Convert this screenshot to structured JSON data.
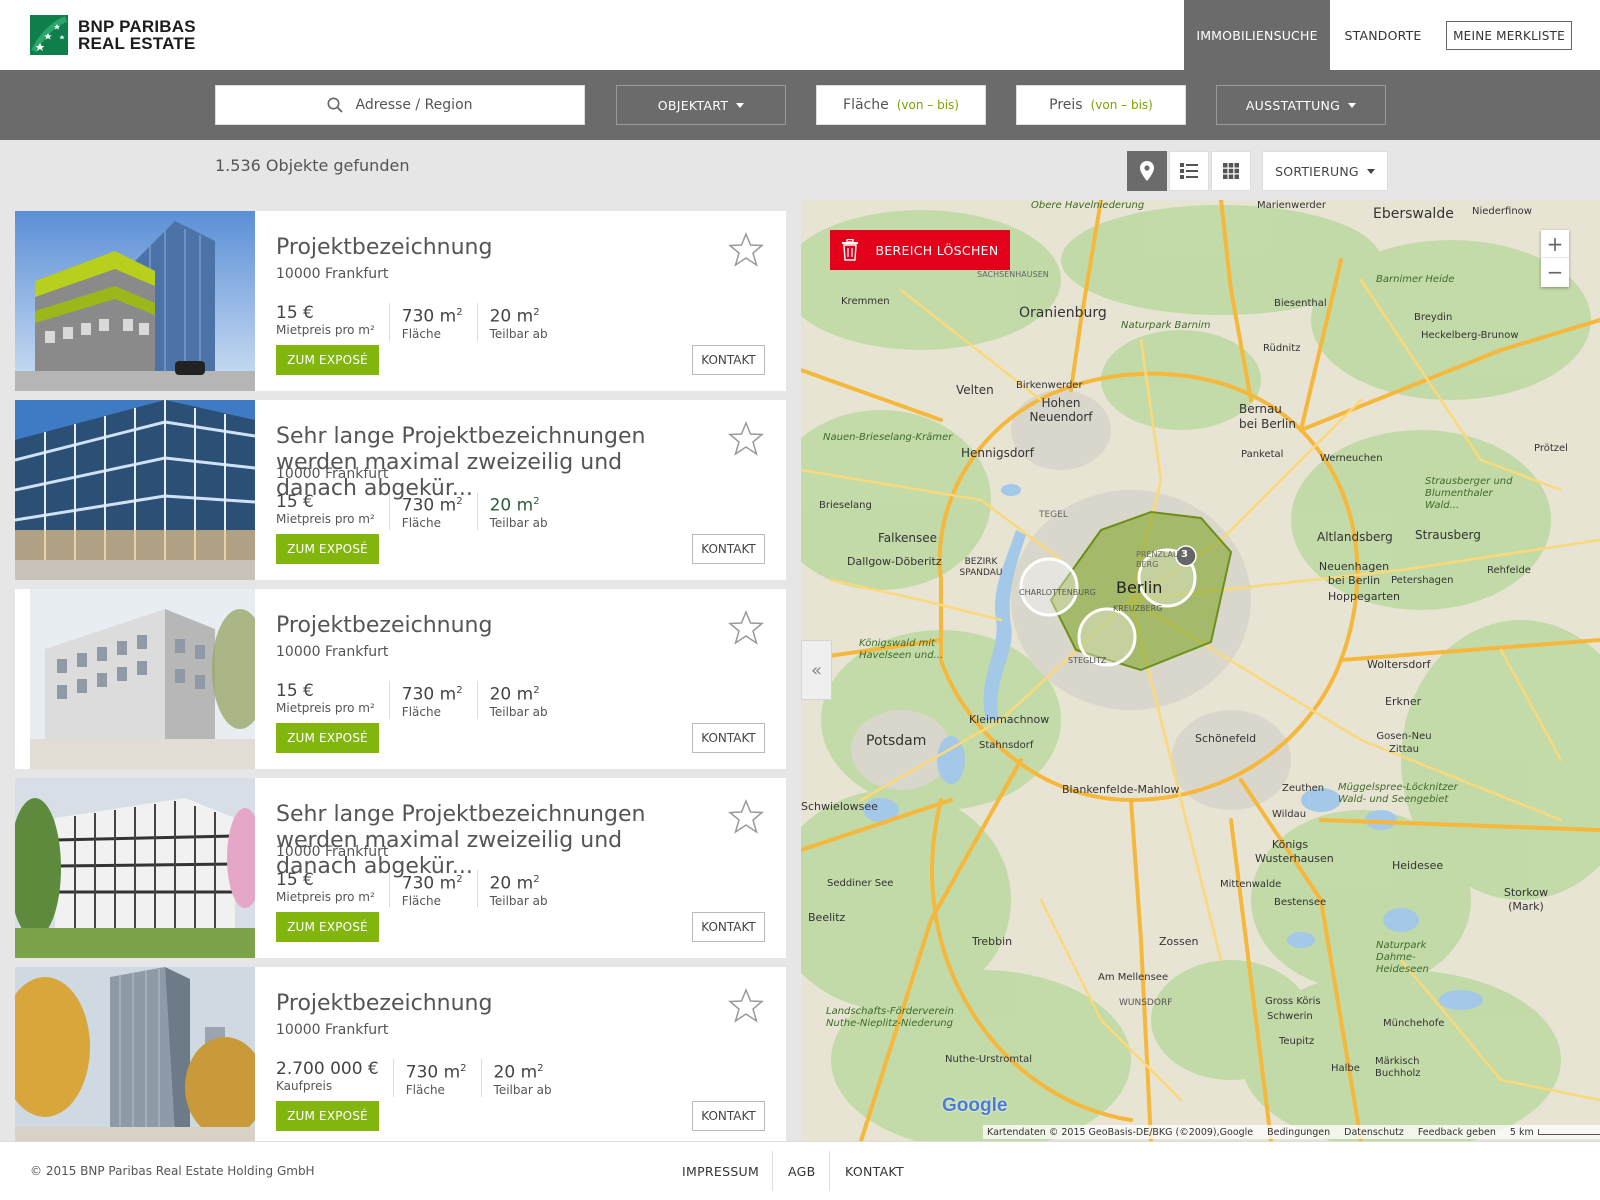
{
  "header": {
    "logo_line1": "BNP PARIBAS",
    "logo_line2": "REAL ESTATE",
    "nav_search": "IMMOBILIENSUCHE",
    "nav_locations": "STANDORTE",
    "nav_watchlist": "MEINE MERKLISTE"
  },
  "search": {
    "address_placeholder": "Adresse / Region",
    "type_label": "OBJEKTART",
    "area_label": "Fläche",
    "area_range": "(von – bis)",
    "price_label": "Preis",
    "price_range": "(von – bis)",
    "equipment_label": "AUSSTATTUNG"
  },
  "results": {
    "count_text": "1.536 Objekte gefunden",
    "sort_label": "SORTIERUNG"
  },
  "listings": [
    {
      "title": "Projektbezeichnung",
      "city": "10000 Frankfurt",
      "price": "15 €",
      "price_label": "Mietpreis pro m²",
      "area": "730 m",
      "area_label": "Fläche",
      "divisible": "20 m",
      "divisible_label": "Teilbar ab",
      "expose": "ZUM EXPOSÉ",
      "contact": "KONTAKT"
    },
    {
      "title": "Sehr lange Projektbezeichnungen werden maximal zweizeilig und danach abgekür...",
      "city": "10000 Frankfurt",
      "price": "15 €",
      "price_label": "Mietpreis pro m²",
      "area": "730 m",
      "area_label": "Fläche",
      "divisible": "20 m",
      "divisible_label": "Teilbar ab",
      "expose": "ZUM EXPOSÉ",
      "contact": "KONTAKT"
    },
    {
      "title": "Projektbezeichnung",
      "city": "10000 Frankfurt",
      "price": "15 €",
      "price_label": "Mietpreis pro m²",
      "area": "730 m",
      "area_label": "Fläche",
      "divisible": "20 m",
      "divisible_label": "Teilbar ab",
      "expose": "ZUM EXPOSÉ",
      "contact": "KONTAKT"
    },
    {
      "title": "Sehr lange Projektbezeichnungen werden maximal zweizeilig und danach abgekür...",
      "city": "10000 Frankfurt",
      "price": "15 €",
      "price_label": "Mietpreis pro m²",
      "area": "730 m",
      "area_label": "Fläche",
      "divisible": "20 m",
      "divisible_label": "Teilbar ab",
      "expose": "ZUM EXPOSÉ",
      "contact": "KONTAKT"
    },
    {
      "title": "Projektbezeichnung",
      "city": "10000 Frankfurt",
      "price": "2.700 000 €",
      "price_label": "Kaufpreis",
      "area": "730 m",
      "area_label": "Fläche",
      "divisible": "20 m",
      "divisible_label": "Teilbar ab",
      "expose": "ZUM EXPOSÉ",
      "contact": "KONTAKT"
    }
  ],
  "map": {
    "clear_area": "BEREICH LÖSCHEN",
    "zoom_in": "+",
    "zoom_out": "−",
    "cluster_count": "3",
    "city_main": "Berlin",
    "places": {
      "eberswalde": "Eberswalde",
      "marienwerder": "Marienwerder",
      "niederfinow": "Niederfinow",
      "obere_havel": "Obere Havelniederung",
      "oranienburg": "Oranienburg",
      "kremmen": "Kremmen",
      "biesenthal": "Biesenthal",
      "barnimer_heide": "Barnimer Heide",
      "breydin": "Breydin",
      "heckelberg": "Heckelberg-Brunow",
      "naturpark_barnim": "Naturpark Barnim",
      "ruednitz": "Rüdnitz",
      "velten": "Velten",
      "birkenwerder": "Birkenwerder",
      "hohen_neuendorf": "Hohen Neuendorf",
      "bernau": "Bernau bei Berlin",
      "nauen": "Nauen-Brieselang-Krämer",
      "hennigsdorf": "Hennigsdorf",
      "panketal": "Panketal",
      "werneuchen": "Werneuchen",
      "brieselang": "Brieselang",
      "falkensee": "Falkensee",
      "dallgow": "Dallgow-Döberitz",
      "spandau": "BEZIRK SPANDAU",
      "tegel": "TEGEL",
      "prenzlauer": "PRENZLAUER BERG",
      "charlottenburg": "CHARLOTTENBURG",
      "kreuzberg": "KREUZBERG",
      "steglitz": "STEGLITZ",
      "altlandsberg": "Altlandsberg",
      "strausberg": "Strausberg",
      "neuenhagen": "Neuenhagen bei Berlin",
      "petershagen": "Petershagen",
      "hoppegarten": "Hoppegarten",
      "koenigswald": "Königswald mit Havelseen und...",
      "woltersdorf": "Woltersdorf",
      "erkner": "Erkner",
      "kleinmachnow": "Kleinmachnow",
      "potsdam": "Potsdam",
      "stahnsdorf": "Stahnsdorf",
      "schoenefeld": "Schönefeld",
      "gosen": "Gosen-Neu Zittau",
      "blankenfelde": "Blankenfelde-Mahlow",
      "zeuthen": "Zeuthen",
      "wildau": "Wildau",
      "mueggelspree": "Müggelspree-Löcknitzer Wald- und Seengebiet",
      "schwielowsee": "Schwielowsee",
      "koenigs": "Königs Wusterhausen",
      "heidesee": "Heidesee",
      "mittenwalde": "Mittenwalde",
      "seddiner": "Seddiner See",
      "bestensee": "Bestensee",
      "storkow": "Storkow (Mark)",
      "beelitz": "Beelitz",
      "trebbin": "Trebbin",
      "zossen": "Zossen",
      "dahme": "Naturpark Dahme-Heideseen",
      "am_mellensee": "Am Mellensee",
      "wunsdorf": "WUNSDORF",
      "gross_koris": "Gross Köris",
      "schwerin": "Schwerin",
      "muenchehofe": "Münchehofe",
      "nuthe": "Landschafts-Förderverein Nuthe-Nieplitz-Niederung",
      "teupitz": "Teupitz",
      "nuthe_urstromtal": "Nuthe-Urstromtal",
      "halbe": "Halbe",
      "maerkisch": "Märkisch Buchholz",
      "rehfelde": "Rehfelde",
      "proetzel": "Prötzel",
      "strausberger": "Strausberger und Blumenthaler Wald...",
      "sachsenhausen": "SACHSENHAUSEN"
    },
    "attribution": "Kartendaten © 2015 GeoBasis-DE/BKG (©2009),Google",
    "terms": "Bedingungen",
    "privacy": "Datenschutz",
    "feedback": "Feedback geben",
    "scale": "5 km",
    "google": "Google"
  },
  "footer": {
    "copyright": "© 2015 BNP Paribas Real Estate Holding GmbH",
    "imprint": "IMPRESSUM",
    "agb": "AGB",
    "contact": "KONTAKT"
  },
  "colors": {
    "accent_green": "#82b50e",
    "header_gray": "#6b6b6b",
    "alert_red": "#e2001a",
    "brand_green": "#0f7e4a"
  },
  "icons": [
    "search-icon",
    "caret-down-icon",
    "map-pin-icon",
    "list-icon",
    "grid-icon",
    "star-icon",
    "trash-icon",
    "chevron-left-icon"
  ]
}
